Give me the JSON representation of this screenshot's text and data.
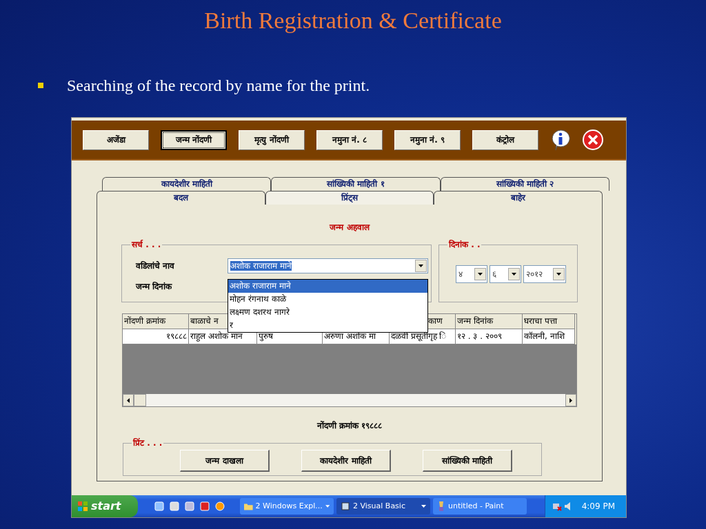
{
  "slide": {
    "title": "Birth Registration & Certificate",
    "bullet": "Searching of the record by name for the print."
  },
  "toolbar": {
    "buttons": [
      {
        "label": "अजेंडा",
        "selected": false
      },
      {
        "label": "जन्म नोंदणी",
        "selected": true
      },
      {
        "label": "मृत्यु नोंदणी",
        "selected": false
      },
      {
        "label": "नमुना नं. ८",
        "selected": false
      },
      {
        "label": "नमुना नं. ९",
        "selected": false
      },
      {
        "label": "कंट्रोल",
        "selected": false
      }
    ]
  },
  "tabs_back": [
    {
      "label": "कायदेशीर माहिती"
    },
    {
      "label": "सांख्यिकी माहिती १"
    },
    {
      "label": "सांख्यिकी माहिती २"
    }
  ],
  "tabs": [
    {
      "label": "बदल",
      "selected": false
    },
    {
      "label": "प्रिंट्स",
      "selected": true
    },
    {
      "label": "बाहेर",
      "selected": false
    }
  ],
  "heading": "जन्म अहवाल",
  "search": {
    "title": "सर्च . . .",
    "father_label": "वडिलांचे नाव",
    "date_label": "जन्म दिनांक",
    "value": "अशोक राजाराम माने",
    "options": [
      {
        "label": "अशोक राजाराम माने",
        "selected": true
      },
      {
        "label": "मोहन रंगनाथ काळे",
        "selected": false
      },
      {
        "label": "लक्ष्मण दशरथ नागरे",
        "selected": false
      },
      {
        "label": "र",
        "selected": false
      }
    ]
  },
  "date": {
    "title": "दिनांक . .",
    "fields": [
      "४",
      "६",
      "२०१२"
    ]
  },
  "table": {
    "columns": [
      "नोंदणी क्रमांक",
      "बाळाचे न",
      "",
      "",
      "काण",
      "जन्म दिनांक",
      "घराचा पत्ता"
    ],
    "rows": [
      [
        "१९८८८",
        "राहुल अशोक मान",
        "पुरुष",
        "अरुणा अशोक मा",
        "दळवी प्रसूतीगृह ि",
        "१२ . ३ . २००९",
        "कॉलनी, नाशि"
      ]
    ]
  },
  "record": "नोंदणी क्रमांक १९८८८",
  "print": {
    "title": "प्रिंट . . .",
    "buttons": [
      "जन्म दाखला",
      "कायदेशीर माहिती",
      "सांख्यिकी माहिती"
    ]
  },
  "taskbar": {
    "start": "start",
    "tasks": [
      {
        "label": "2 Windows Expl...",
        "selected": false,
        "menu": true
      },
      {
        "label": "2 Visual Basic",
        "selected": true,
        "menu": true
      },
      {
        "label": "untitled - Paint",
        "selected": false,
        "menu": false
      }
    ],
    "clock": "4:09 PM"
  }
}
